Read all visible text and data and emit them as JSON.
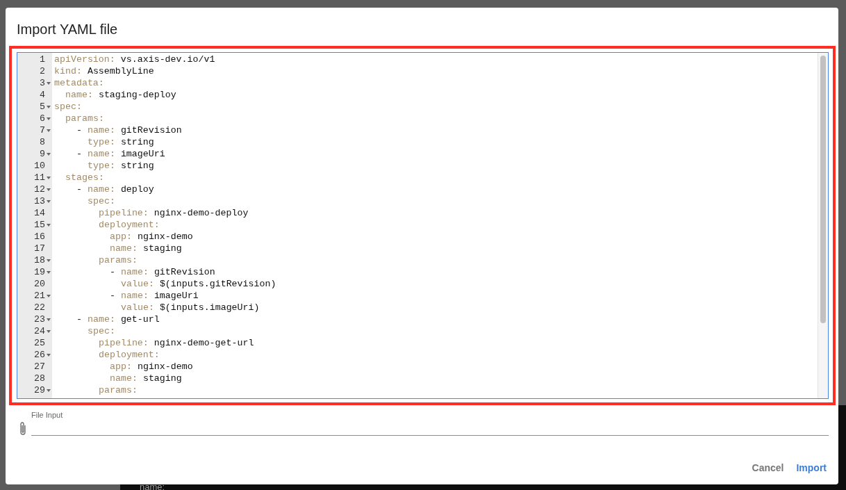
{
  "backdrop": {
    "text": "name:"
  },
  "dialog": {
    "title": "Import YAML file",
    "editor": {
      "lines": [
        {
          "line": "1",
          "fold": false,
          "key": "apiVersion:",
          "value": "vs.axis-dev.io/v1"
        },
        {
          "line": "2",
          "fold": false,
          "key": "kind:",
          "value": "AssemblyLine"
        },
        {
          "line": "3",
          "fold": true,
          "key": "metadata:",
          "children": [
            {
              "line": "4",
              "fold": false,
              "key": "name:",
              "value": "staging-deploy"
            }
          ]
        },
        {
          "line": "5",
          "fold": true,
          "key": "spec:",
          "children": [
            {
              "line": "6",
              "fold": true,
              "key": "params:",
              "children": [
                {
                  "line": "7",
                  "fold": true,
                  "dash": "-",
                  "key": "name:",
                  "value": "gitRevision",
                  "children": [
                    {
                      "line": "8",
                      "fold": false,
                      "key": "type:",
                      "value": "string"
                    }
                  ]
                },
                {
                  "line": "9",
                  "fold": true,
                  "dash": "-",
                  "key": "name:",
                  "value": "imageUri",
                  "children": [
                    {
                      "line": "10",
                      "fold": false,
                      "key": "type:",
                      "value": "string"
                    }
                  ]
                }
              ]
            },
            {
              "line": "11",
              "fold": true,
              "key": "stages:",
              "children": [
                {
                  "line": "12",
                  "fold": true,
                  "dash": "-",
                  "key": "name:",
                  "value": "deploy",
                  "children": [
                    {
                      "line": "13",
                      "fold": true,
                      "key": "spec:",
                      "children": [
                        {
                          "line": "14",
                          "fold": false,
                          "key": "pipeline:",
                          "value": "nginx-demo-deploy"
                        },
                        {
                          "line": "15",
                          "fold": true,
                          "key": "deployment:",
                          "children": [
                            {
                              "line": "16",
                              "fold": false,
                              "key": "app:",
                              "value": "nginx-demo"
                            },
                            {
                              "line": "17",
                              "fold": false,
                              "key": "name:",
                              "value": "staging"
                            }
                          ]
                        },
                        {
                          "line": "18",
                          "fold": true,
                          "key": "params:",
                          "children": [
                            {
                              "line": "19",
                              "fold": true,
                              "dash": "-",
                              "key": "name:",
                              "value": "gitRevision",
                              "children": [
                                {
                                  "line": "20",
                                  "fold": false,
                                  "key": "value:",
                                  "value": "$(inputs.gitRevision)"
                                }
                              ]
                            },
                            {
                              "line": "21",
                              "fold": true,
                              "dash": "-",
                              "key": "name:",
                              "value": "imageUri",
                              "children": [
                                {
                                  "line": "22",
                                  "fold": false,
                                  "key": "value:",
                                  "value": "$(inputs.imageUri)"
                                }
                              ]
                            }
                          ]
                        }
                      ]
                    }
                  ]
                },
                {
                  "line": "23",
                  "fold": true,
                  "dash": "-",
                  "key": "name:",
                  "value": "get-url",
                  "children": [
                    {
                      "line": "24",
                      "fold": true,
                      "key": "spec:",
                      "children": [
                        {
                          "line": "25",
                          "fold": false,
                          "key": "pipeline:",
                          "value": "nginx-demo-get-url"
                        },
                        {
                          "line": "26",
                          "fold": true,
                          "key": "deployment:",
                          "children": [
                            {
                              "line": "27",
                              "fold": false,
                              "key": "app:",
                              "value": "nginx-demo"
                            },
                            {
                              "line": "28",
                              "fold": false,
                              "key": "name:",
                              "value": "staging"
                            }
                          ]
                        },
                        {
                          "line": "29",
                          "fold": true,
                          "key": "params:"
                        }
                      ]
                    }
                  ]
                }
              ]
            }
          ]
        }
      ]
    },
    "file_input": {
      "label": "File Input"
    },
    "buttons": [
      {
        "label": "Cancel",
        "kind": "secondary"
      },
      {
        "label": "Import",
        "kind": "primary"
      }
    ]
  }
}
